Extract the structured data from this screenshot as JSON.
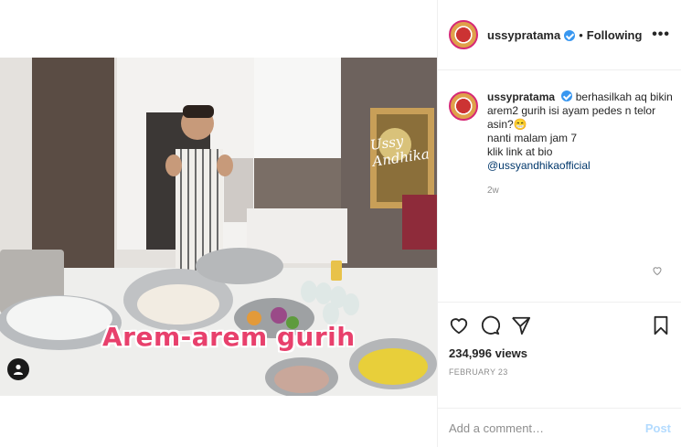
{
  "post": {
    "video_overlay_text": "Arem-arem gurih",
    "watermark_text": "Ussy Andhika",
    "video_icon": "person-icon"
  },
  "header": {
    "username": "ussypratama",
    "separator": "•",
    "follow_status": "Following",
    "more": "•••"
  },
  "caption": {
    "username": "ussypratama",
    "line1": "berhasilkah aq bikin arem2 gurih isi ayam pedes n telor asin?😁",
    "line2": "nanti malam jam 7",
    "line3": "klik link at bio",
    "mention": "@ussyandhikaofficial",
    "time_ago": "2w"
  },
  "stats": {
    "views": "234,996 views",
    "date": "FEBRUARY 23"
  },
  "comment_box": {
    "placeholder": "Add a comment…",
    "post_label": "Post"
  },
  "colors": {
    "verified": "#3897f0",
    "link": "#00376b",
    "post_disabled": "#b3dbff",
    "overlay_text": "#e8406c"
  }
}
